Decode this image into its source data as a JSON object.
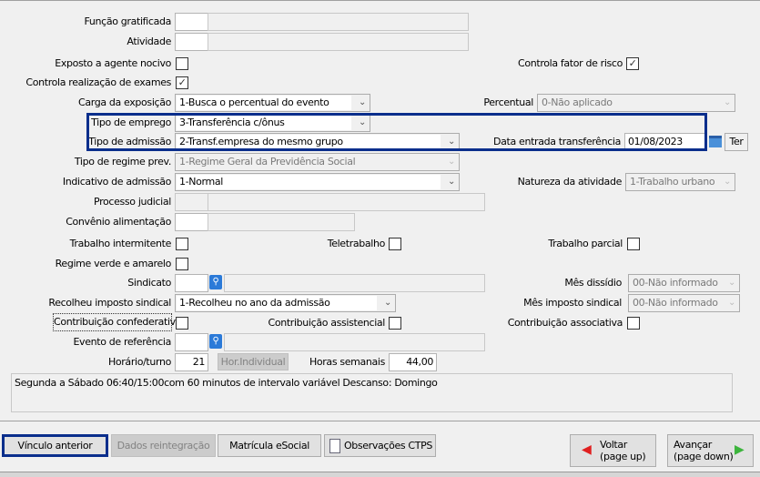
{
  "fields": {
    "funcao_gratificada": {
      "label": "Função gratificada",
      "code": "",
      "desc": ""
    },
    "atividade": {
      "label": "Atividade",
      "code": "",
      "desc": ""
    },
    "exposto": {
      "label": "Exposto a agente nocivo",
      "checked": false
    },
    "controla_fator": {
      "label": "Controla fator de risco",
      "checked": true,
      "mark": "✓"
    },
    "controla_exames": {
      "label": "Controla realização de exames",
      "checked": true,
      "mark": "✓"
    },
    "carga": {
      "label": "Carga da exposição",
      "value": "1-Busca o percentual do evento"
    },
    "percentual": {
      "label": "Percentual",
      "value": "0-Não aplicado"
    },
    "tipo_emprego": {
      "label": "Tipo de emprego",
      "value": "3-Transferência c/ônus"
    },
    "tipo_admissao": {
      "label": "Tipo de admissão",
      "value": "2-Transf.empresa do mesmo grupo"
    },
    "data_transferencia": {
      "label": "Data entrada transferência",
      "value": "01/08/2023",
      "button": "Ter"
    },
    "tipo_regime": {
      "label": "Tipo de regime prev.",
      "value": "1-Regime Geral da Previdência Social"
    },
    "indicativo": {
      "label": "Indicativo de admissão",
      "value": "1-Normal"
    },
    "natureza": {
      "label": "Natureza da atividade",
      "value": "1-Trabalho urbano"
    },
    "processo": {
      "label": "Processo judicial"
    },
    "convenio": {
      "label": "Convênio alimentação"
    },
    "intermitente": {
      "label": "Trabalho intermitente"
    },
    "teletrabalho": {
      "label": "Teletrabalho"
    },
    "parcial": {
      "label": "Trabalho parcial"
    },
    "verde_amarelo": {
      "label": "Regime verde e amarelo"
    },
    "sindicato": {
      "label": "Sindicato"
    },
    "mes_dissidio": {
      "label": "Mês dissídio",
      "value": "00-Não informado"
    },
    "recolheu": {
      "label": "Recolheu imposto sindical",
      "value": "1-Recolheu no ano da admissão"
    },
    "mes_imposto": {
      "label": "Mês imposto sindical",
      "value": "00-Não informado"
    },
    "confederativa": {
      "label": "Contribuição confederativa"
    },
    "assistencial": {
      "label": "Contribuição assistencial"
    },
    "associativa": {
      "label": "Contribuição associativa"
    },
    "evento": {
      "label": "Evento de referência"
    },
    "horario": {
      "label": "Horário/turno",
      "value": "21",
      "button": "Hor.Individual"
    },
    "horas_semanais": {
      "label": "Horas semanais",
      "value": "44,00"
    },
    "descricao_horario": "Segunda a Sábado 06:40/15:00com 60 minutos de intervalo variável Descanso: Domingo"
  },
  "buttons": {
    "vinculo": "Vínculo anterior",
    "reintegracao": "Dados reintegração",
    "matricula": "Matrícula eSocial",
    "observacoes": "Observações CTPS",
    "voltar": "Voltar",
    "voltar_sub": "(page up)",
    "avancar": "Avançar",
    "avancar_sub": "(page down)"
  },
  "colors": {
    "highlight": "#0a2e8c"
  }
}
